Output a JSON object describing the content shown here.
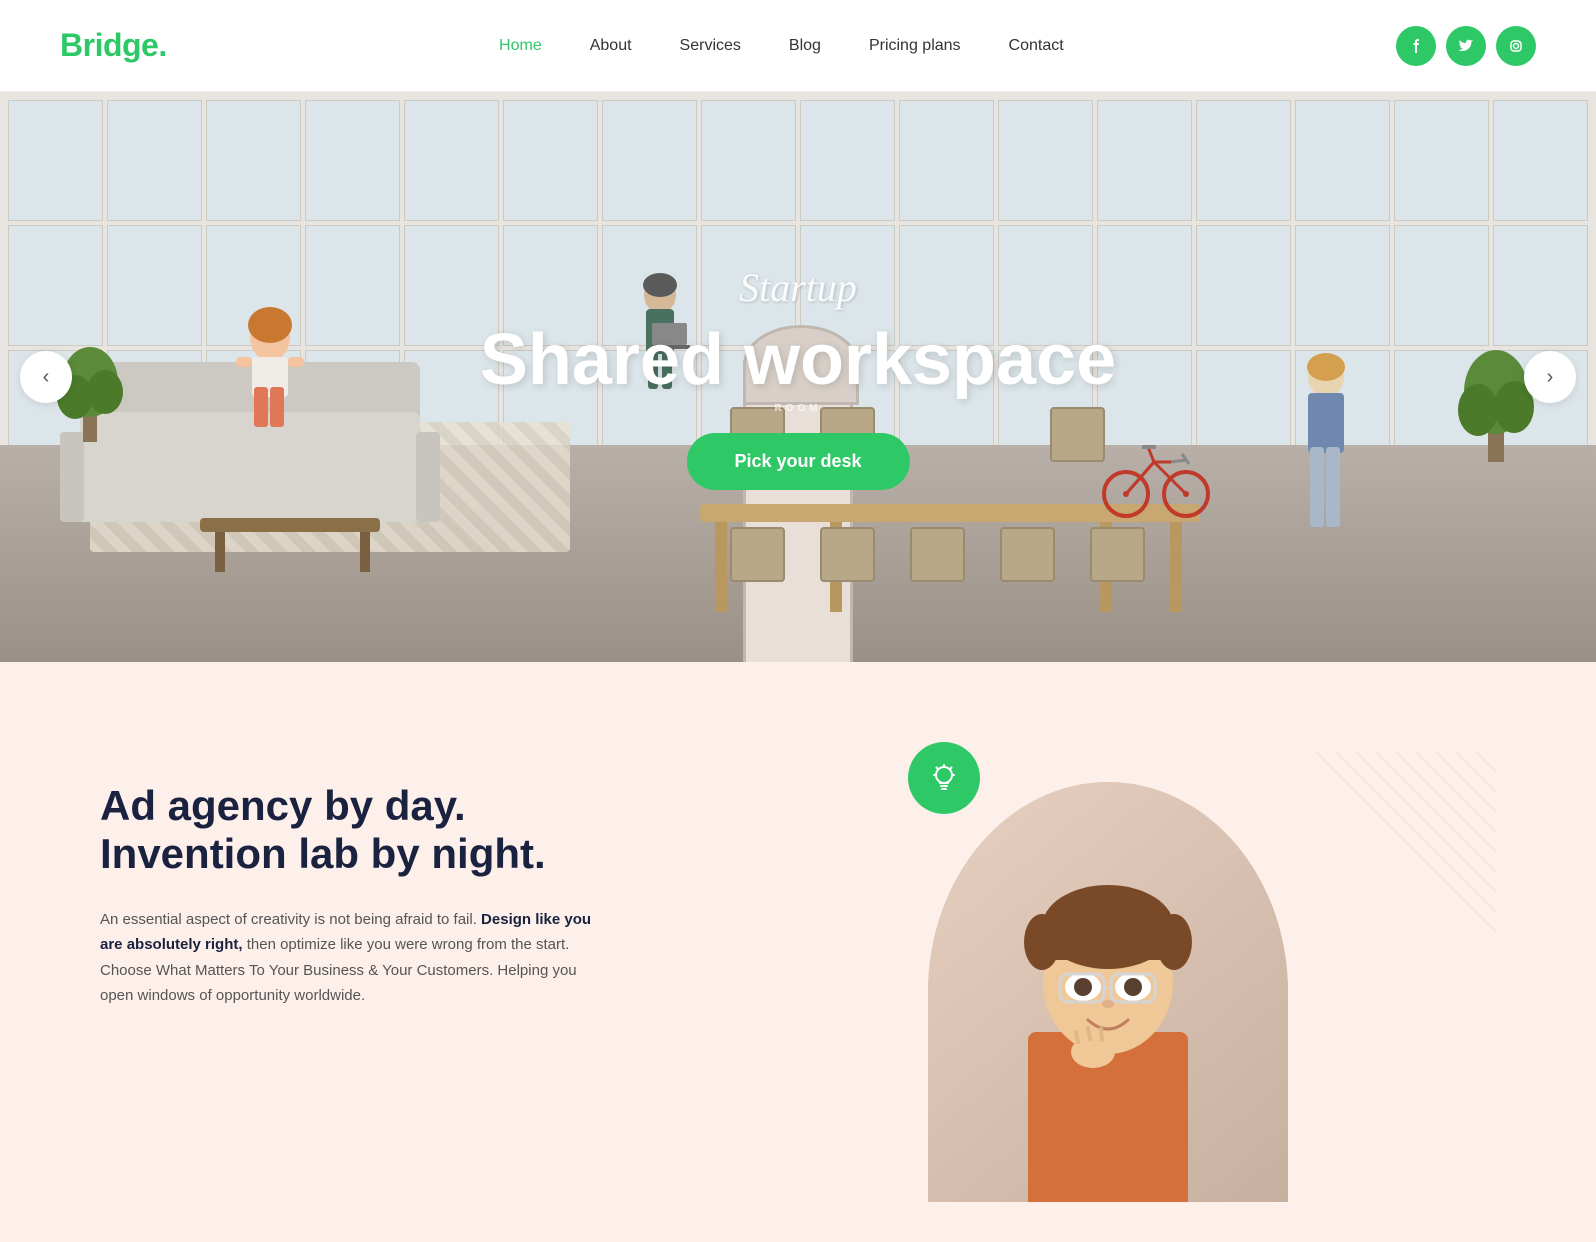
{
  "header": {
    "logo": {
      "text": "Bridge",
      "dot": "."
    },
    "nav": {
      "items": [
        {
          "label": "Home",
          "active": true
        },
        {
          "label": "About",
          "active": false
        },
        {
          "label": "Services",
          "active": false
        },
        {
          "label": "Blog",
          "active": false
        },
        {
          "label": "Pricing plans",
          "active": false
        },
        {
          "label": "Contact",
          "active": false
        }
      ]
    },
    "social": [
      {
        "name": "facebook",
        "icon": "f"
      },
      {
        "name": "twitter",
        "icon": "t"
      },
      {
        "name": "instagram",
        "icon": "in"
      }
    ]
  },
  "hero": {
    "subtitle": "Startup",
    "title": "Shared workspace",
    "room_label": "ROOM",
    "cta_label": "Pick your desk",
    "arrow_left": "‹",
    "arrow_right": "›"
  },
  "section": {
    "heading_line1": "Ad agency by day.",
    "heading_line2": "Invention lab by night.",
    "body_intro": "An essential aspect of creativity is not being afraid to fail.",
    "body_bold": "Design like you are absolutely right,",
    "body_rest": " then optimize like you were wrong from the start. Choose What Matters To Your Business & Your Customers. Helping you open windows of opportunity worldwide.",
    "bulb_icon": "💡"
  },
  "colors": {
    "accent": "#2ec866",
    "dark_text": "#1a2240",
    "light_bg": "#fdf0eb",
    "body_text": "#555555"
  }
}
